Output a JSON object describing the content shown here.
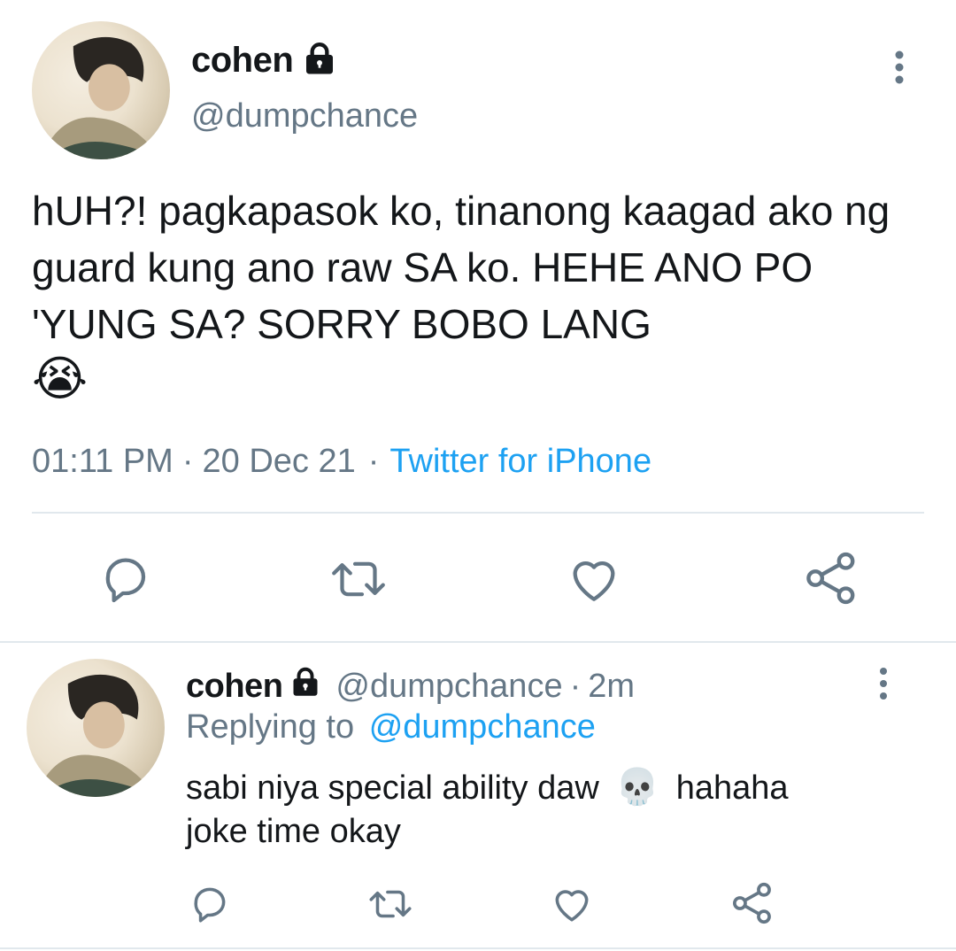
{
  "main_tweet": {
    "display_name": "cohen",
    "handle": "@dumpchance",
    "text": "hUH?! pagkapasok ko, tinanong kaagad ako ng guard kung ano raw SA ko. HEHE ANO PO 'YUNG SA? SORRY BOBO LANG",
    "emoji": "😭",
    "time": "01:11 PM",
    "date": "20 Dec 21",
    "source": "Twitter for iPhone",
    "separator": "·"
  },
  "reply_tweet": {
    "display_name": "cohen",
    "handle": "@dumpchance",
    "age": "2m",
    "separator": "·",
    "replying_prefix": "Replying to",
    "replying_handle": "@dumpchance",
    "text_before_emoji": "sabi niya special ability daw",
    "emoji": "💀",
    "text_after_emoji": "hahaha",
    "text_line2": "joke time okay"
  },
  "colors": {
    "text": "#14171a",
    "muted": "#657786",
    "accent": "#1da1f2",
    "divider": "#e1e8ed"
  },
  "icons": {
    "lock": "lock-icon",
    "more": "more-vertical-icon",
    "reply": "reply-icon",
    "retweet": "retweet-icon",
    "like": "heart-icon",
    "share": "share-icon"
  }
}
